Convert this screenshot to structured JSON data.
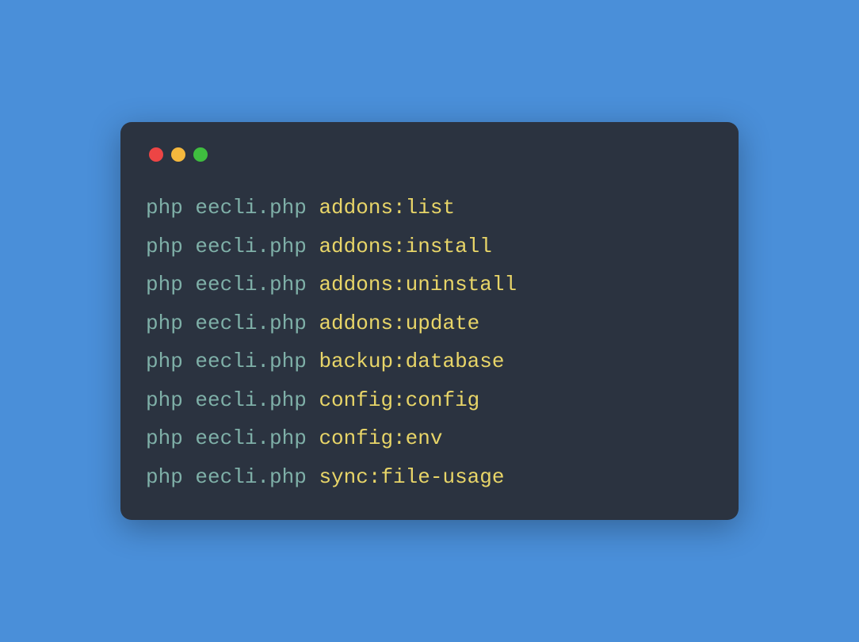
{
  "lines": [
    {
      "prefix": "php eecli.php ",
      "command": "addons:list"
    },
    {
      "prefix": "php eecli.php ",
      "command": "addons:install"
    },
    {
      "prefix": "php eecli.php ",
      "command": "addons:uninstall"
    },
    {
      "prefix": "php eecli.php ",
      "command": "addons:update"
    },
    {
      "prefix": "php eecli.php ",
      "command": "backup:database"
    },
    {
      "prefix": "php eecli.php ",
      "command": "config:config"
    },
    {
      "prefix": "php eecli.php ",
      "command": "config:env"
    },
    {
      "prefix": "php eecli.php ",
      "command": "sync:file-usage"
    }
  ]
}
